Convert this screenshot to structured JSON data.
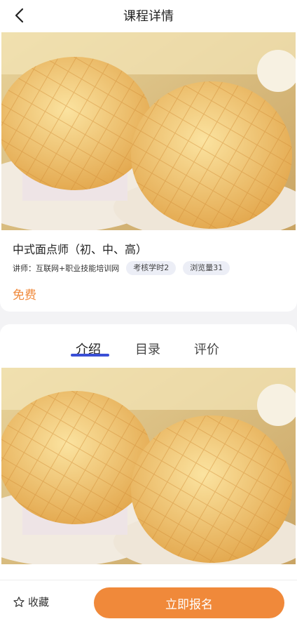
{
  "header": {
    "title": "课程详情"
  },
  "course": {
    "name": "中式面点师（初、中、高）",
    "teacher": "讲师：互联网+职业技能培训网",
    "tag_hours": "考核学时2",
    "tag_views": "浏览量31",
    "price": "免费"
  },
  "tabs": [
    {
      "label": "介绍",
      "active": true
    },
    {
      "label": "目录",
      "active": false
    },
    {
      "label": "评价",
      "active": false
    }
  ],
  "bottom": {
    "favorite_label": "收藏",
    "enroll_label": "立即报名"
  },
  "icons": {
    "back": "chevron-left-icon",
    "favorite": "star-outline-icon"
  },
  "colors": {
    "accent": "#f08a3c",
    "tab_indicator": "#3a4fd6",
    "tag_bg": "#eceef6"
  }
}
